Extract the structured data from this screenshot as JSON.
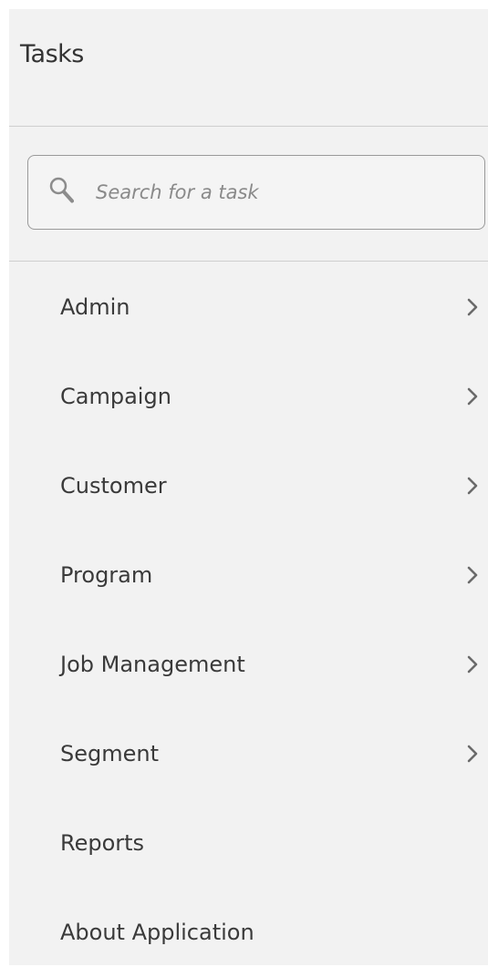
{
  "header": {
    "title": "Tasks"
  },
  "search": {
    "placeholder": "Search for a task",
    "value": "",
    "icon": "search-icon"
  },
  "menu": {
    "items": [
      {
        "label": "Admin",
        "has_submenu": true
      },
      {
        "label": "Campaign",
        "has_submenu": true
      },
      {
        "label": "Customer",
        "has_submenu": true
      },
      {
        "label": "Program",
        "has_submenu": true
      },
      {
        "label": "Job Management",
        "has_submenu": true
      },
      {
        "label": "Segment",
        "has_submenu": true
      },
      {
        "label": "Reports",
        "has_submenu": false
      },
      {
        "label": "About Application",
        "has_submenu": false
      }
    ]
  },
  "colors": {
    "panel_background": "#f2f2f2",
    "text": "#3a3a3a",
    "divider": "#cfcfcf",
    "chevron": "#6a6a6a"
  }
}
